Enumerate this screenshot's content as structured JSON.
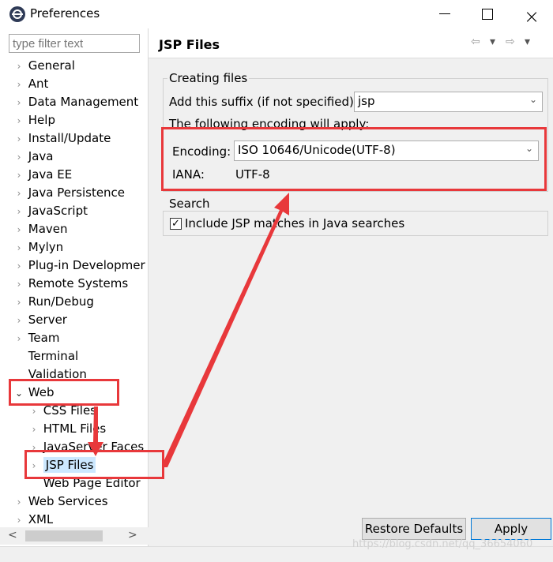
{
  "window": {
    "title": "Preferences"
  },
  "filter": {
    "placeholder": "type filter text"
  },
  "tree": {
    "items": [
      {
        "label": "General",
        "expander": "right"
      },
      {
        "label": "Ant",
        "expander": "right"
      },
      {
        "label": "Data Management",
        "expander": "right"
      },
      {
        "label": "Help",
        "expander": "right"
      },
      {
        "label": "Install/Update",
        "expander": "right"
      },
      {
        "label": "Java",
        "expander": "right"
      },
      {
        "label": "Java EE",
        "expander": "right"
      },
      {
        "label": "Java Persistence",
        "expander": "right"
      },
      {
        "label": "JavaScript",
        "expander": "right"
      },
      {
        "label": "Maven",
        "expander": "right"
      },
      {
        "label": "Mylyn",
        "expander": "right"
      },
      {
        "label": "Plug-in Developmer",
        "expander": "right"
      },
      {
        "label": "Remote Systems",
        "expander": "right"
      },
      {
        "label": "Run/Debug",
        "expander": "right"
      },
      {
        "label": "Server",
        "expander": "right"
      },
      {
        "label": "Team",
        "expander": "right"
      },
      {
        "label": "Terminal",
        "expander": "none"
      },
      {
        "label": "Validation",
        "expander": "none"
      },
      {
        "label": "Web",
        "expander": "down"
      },
      {
        "label": "CSS Files",
        "expander": "right",
        "child": true
      },
      {
        "label": "HTML Files",
        "expander": "right",
        "child": true
      },
      {
        "label": "JavaServer Faces",
        "expander": "right",
        "child": true
      },
      {
        "label": "JSP Files",
        "expander": "right",
        "child": true,
        "selected": true
      },
      {
        "label": "Web Page Editor",
        "expander": "none",
        "child": true
      },
      {
        "label": "Web Services",
        "expander": "right"
      },
      {
        "label": "XML",
        "expander": "right"
      }
    ],
    "scroll_left": "<",
    "scroll_right": ">"
  },
  "page": {
    "title": "JSP Files",
    "nav_back": "⇦",
    "nav_back_menu": "▾",
    "nav_forward": "⇨",
    "nav_forward_menu": "▾"
  },
  "creating_files": {
    "label": "Creating files",
    "suffix_label": "Add this suffix (if not specified):",
    "suffix_value": "jsp",
    "encoding_note": "The following encoding will apply:",
    "encoding_label": "Encoding:",
    "encoding_value": "ISO 10646/Unicode(UTF-8)",
    "iana_label": "IANA:",
    "iana_value": "UTF-8"
  },
  "search": {
    "label": "Search",
    "include_label": "Include JSP matches in Java searches",
    "include_checked": true,
    "check_mark": "✓"
  },
  "buttons": {
    "restore": "Restore Defaults",
    "apply": "Apply"
  },
  "watermark": "https://blog.csdn.net/qq_36654060",
  "colors": {
    "annotation": "#e8383b",
    "selection": "#cce8ff"
  }
}
